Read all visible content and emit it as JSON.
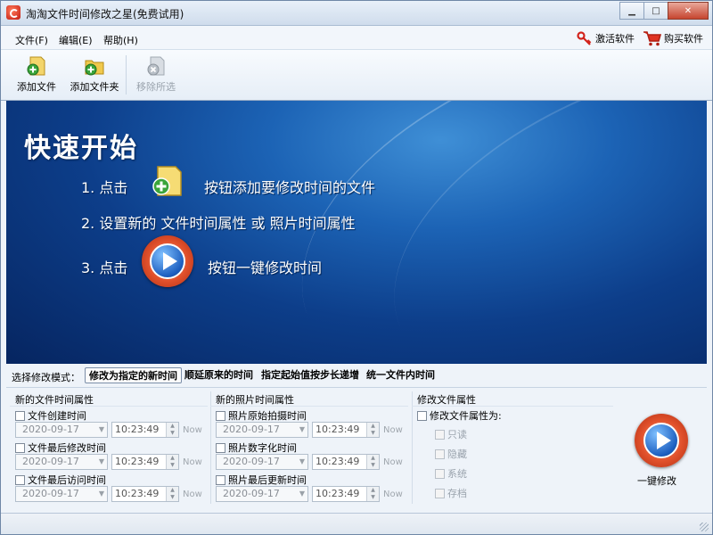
{
  "window": {
    "title": "淘淘文件时间修改之星(免费试用)"
  },
  "menu": {
    "items": [
      "文件(F)",
      "编辑(E)",
      "帮助(H)"
    ],
    "activate": "激活软件",
    "buy": "购买软件"
  },
  "toolbar": {
    "add_file": "添加文件",
    "add_folder": "添加文件夹",
    "remove_selected": "移除所选"
  },
  "banner": {
    "title": "快速开始",
    "step1_prefix": "1.  点击",
    "step1_suffix": "按钮添加要修改时间的文件",
    "step2": "2.  设置新的 文件时间属性 或 照片时间属性",
    "step3_prefix": "3.  点击",
    "step3_suffix": "按钮一键修改时间"
  },
  "mode": {
    "label": "选择修改模式：",
    "tabs": [
      "修改为指定的新时间",
      "顺延原来的时间",
      "指定起始值按步长递增",
      "统一文件内时间"
    ],
    "active_index": 0
  },
  "file_time": {
    "title": "新的文件时间属性",
    "rows": [
      {
        "label": "文件创建时间",
        "date": "2020-09-17",
        "time": "10:23:49",
        "now": "Now"
      },
      {
        "label": "文件最后修改时间",
        "date": "2020-09-17",
        "time": "10:23:49",
        "now": "Now"
      },
      {
        "label": "文件最后访问时间",
        "date": "2020-09-17",
        "time": "10:23:49",
        "now": "Now"
      }
    ]
  },
  "photo_time": {
    "title": "新的照片时间属性",
    "rows": [
      {
        "label": "照片原始拍摄时间",
        "date": "2020-09-17",
        "time": "10:23:49",
        "now": "Now"
      },
      {
        "label": "照片数字化时间",
        "date": "2020-09-17",
        "time": "10:23:49",
        "now": "Now"
      },
      {
        "label": "照片最后更新时间",
        "date": "2020-09-17",
        "time": "10:23:49",
        "now": "Now"
      }
    ]
  },
  "attributes": {
    "title": "修改文件属性",
    "toggle": "修改文件属性为:",
    "options": [
      "只读",
      "隐藏",
      "系统",
      "存档"
    ]
  },
  "action": {
    "one_click": "一键修改"
  },
  "colors": {
    "accent": "#e0502b",
    "banner_blue": "#1c63b5"
  }
}
